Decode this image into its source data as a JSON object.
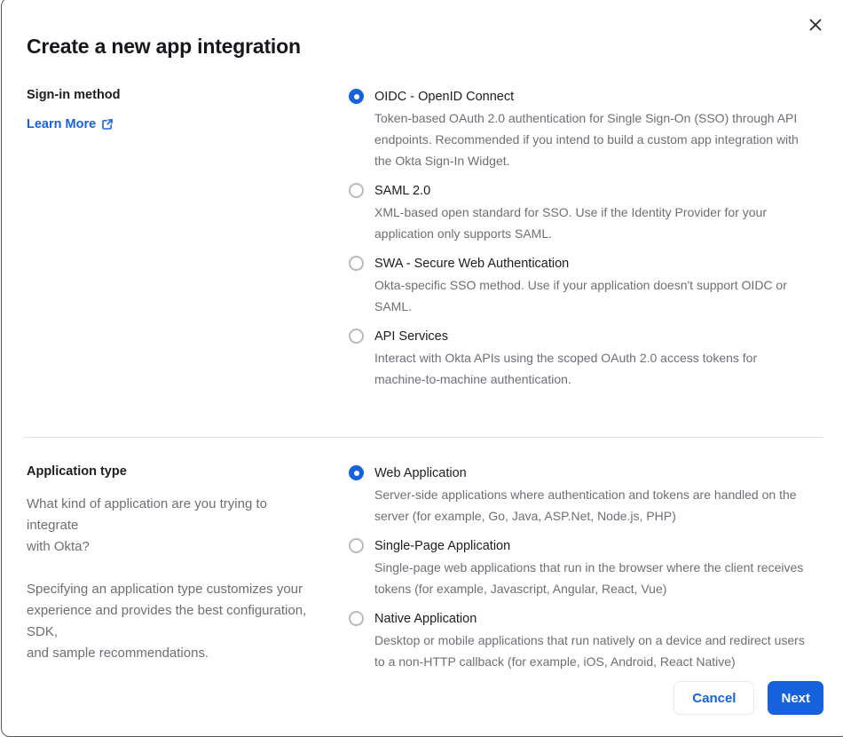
{
  "colors": {
    "accent_blue": "#1662dd",
    "text_dark": "#1d1d21",
    "text_gray": "#6e6e78",
    "modal_border": "#54545b",
    "divider": "#e1e1e6",
    "radio_unselected_border": "#b9b9c1"
  },
  "modal": {
    "title": "Create a new app integration",
    "close_icon": "close-x"
  },
  "signin": {
    "label": "Sign-in method",
    "learn_more_label": "Learn More",
    "learn_more_icon": "external-link-icon",
    "options": [
      {
        "label": "OIDC - OpenID Connect",
        "desc": "Token-based OAuth 2.0 authentication for Single Sign-On (SSO) through API\nendpoints. Recommended if you intend to build a custom app integration with\nthe Okta Sign-In Widget.",
        "selected": true
      },
      {
        "label": "SAML 2.0",
        "desc": "XML-based open standard for SSO. Use if the Identity Provider for your\napplication only supports SAML.",
        "selected": false
      },
      {
        "label": "SWA - Secure Web Authentication",
        "desc": "Okta-specific SSO method. Use if your application doesn't support OIDC or\nSAML.",
        "selected": false
      },
      {
        "label": "API Services",
        "desc": "Interact with Okta APIs using the scoped OAuth 2.0 access tokens for\nmachine-to-machine authentication.",
        "selected": false
      }
    ]
  },
  "apptype": {
    "label": "Application type",
    "para1": "What kind of application are you trying to integrate\nwith Okta?",
    "para2": "Specifying an application type customizes your\nexperience and provides the best configuration, SDK,\nand sample recommendations.",
    "options": [
      {
        "label": "Web Application",
        "desc": "Server-side applications where authentication and tokens are handled on the\nserver (for example, Go, Java, ASP.Net, Node.js, PHP)",
        "selected": true
      },
      {
        "label": "Single-Page Application",
        "desc": "Single-page web applications that run in the browser where the client receives\ntokens (for example, Javascript, Angular, React, Vue)",
        "selected": false
      },
      {
        "label": "Native Application",
        "desc": "Desktop or mobile applications that run natively on a device and redirect users\nto a non-HTTP callback (for example, iOS, Android, React Native)",
        "selected": false
      }
    ]
  },
  "footer": {
    "cancel_label": "Cancel",
    "next_label": "Next"
  }
}
